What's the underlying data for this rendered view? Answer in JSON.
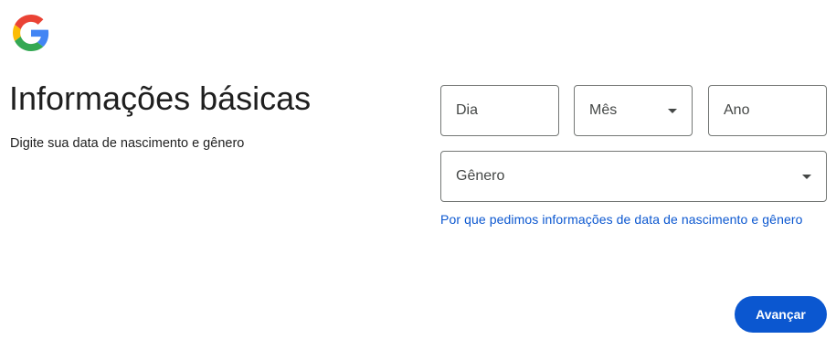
{
  "brand": {
    "logo_icon": "google-g-logo"
  },
  "header": {
    "title": "Informações básicas",
    "subtitle": "Digite sua data de nascimento e gênero"
  },
  "form": {
    "day": {
      "placeholder": "Dia",
      "value": ""
    },
    "month": {
      "label": "Mês",
      "icon": "chevron-down-icon"
    },
    "year": {
      "placeholder": "Ano",
      "value": ""
    },
    "gender": {
      "label": "Gênero",
      "icon": "chevron-down-icon"
    },
    "why_link": "Por que pedimos informações de data de nascimento e gênero"
  },
  "actions": {
    "next_label": "Avançar"
  },
  "colors": {
    "primary": "#0b57d0",
    "border": "#747775",
    "text": "#1f1f1f"
  }
}
